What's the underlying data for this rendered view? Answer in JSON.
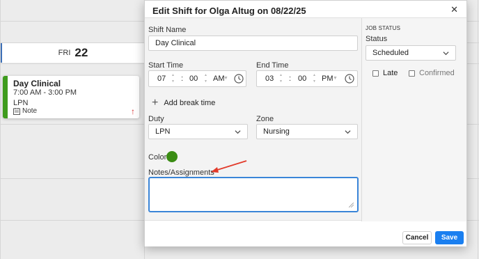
{
  "calendar": {
    "day_header": {
      "dow": "FRI",
      "day": "22"
    },
    "shift_card": {
      "title": "Day Clinical",
      "time": "7:00 AM - 3:00 PM",
      "role": "LPN",
      "note_label": "Note",
      "accent_color": "#3e9b1d",
      "flag_color": "#d42b2b"
    }
  },
  "modal": {
    "title": "Edit Shift for Olga Altug on 08/22/25",
    "close_icon": "close-icon",
    "shift_name": {
      "label": "Shift Name",
      "value": "Day Clinical"
    },
    "start_time": {
      "label": "Start Time",
      "hour": "07",
      "minute": "00",
      "ampm": "AM",
      "icon": "clock-icon"
    },
    "end_time": {
      "label": "End Time",
      "hour": "03",
      "minute": "00",
      "ampm": "PM",
      "icon": "clock-icon"
    },
    "add_break": {
      "label": "Add break time",
      "icon": "plus-icon"
    },
    "duty": {
      "label": "Duty",
      "value": "LPN"
    },
    "zone": {
      "label": "Zone",
      "value": "Nursing"
    },
    "color": {
      "label": "Color",
      "value": "#3a8c13"
    },
    "notes": {
      "label": "Notes/Assignments",
      "value": ""
    },
    "job_status": {
      "heading": "JOB STATUS",
      "status_label": "Status",
      "status_value": "Scheduled",
      "late_label": "Late",
      "confirmed_label": "Confirmed"
    },
    "footer": {
      "cancel": "Cancel",
      "save": "Save",
      "save_color": "#1a7ff0"
    }
  }
}
